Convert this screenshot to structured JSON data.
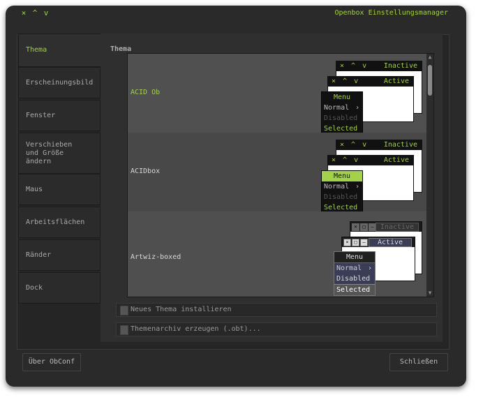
{
  "window": {
    "title": "Openbox Einstellungsmanager",
    "controls": [
      "×",
      "^",
      "v"
    ]
  },
  "sidebar": {
    "items": [
      {
        "label": "Thema",
        "active": true
      },
      {
        "label": "Erscheinungsbild"
      },
      {
        "label": "Fenster"
      },
      {
        "label": "Verschieben\nund Größe ändern"
      },
      {
        "label": "Maus"
      },
      {
        "label": "Arbeitsflächen"
      },
      {
        "label": "Ränder"
      },
      {
        "label": "Dock"
      }
    ]
  },
  "main": {
    "section_title": "Thema",
    "themes": [
      {
        "name": "ACID Ob",
        "selected": true
      },
      {
        "name": "ACIDbox"
      },
      {
        "name": "Artwiz-boxed"
      }
    ],
    "preview": {
      "inactive": "Inactive",
      "active": "Active",
      "menu": {
        "title": "Menu",
        "normal": "Normal",
        "disabled": "Disabled",
        "selected": "Selected"
      },
      "buttons": "× ^ v"
    },
    "install_button": "Neues Thema installieren",
    "archive_button": "Themenarchiv erzeugen (.obt)..."
  },
  "footer": {
    "about_button": "Über ObConf",
    "close_button": "Schließen"
  },
  "colors": {
    "accent": "#a3d14a",
    "background": "#2a2a2a"
  }
}
